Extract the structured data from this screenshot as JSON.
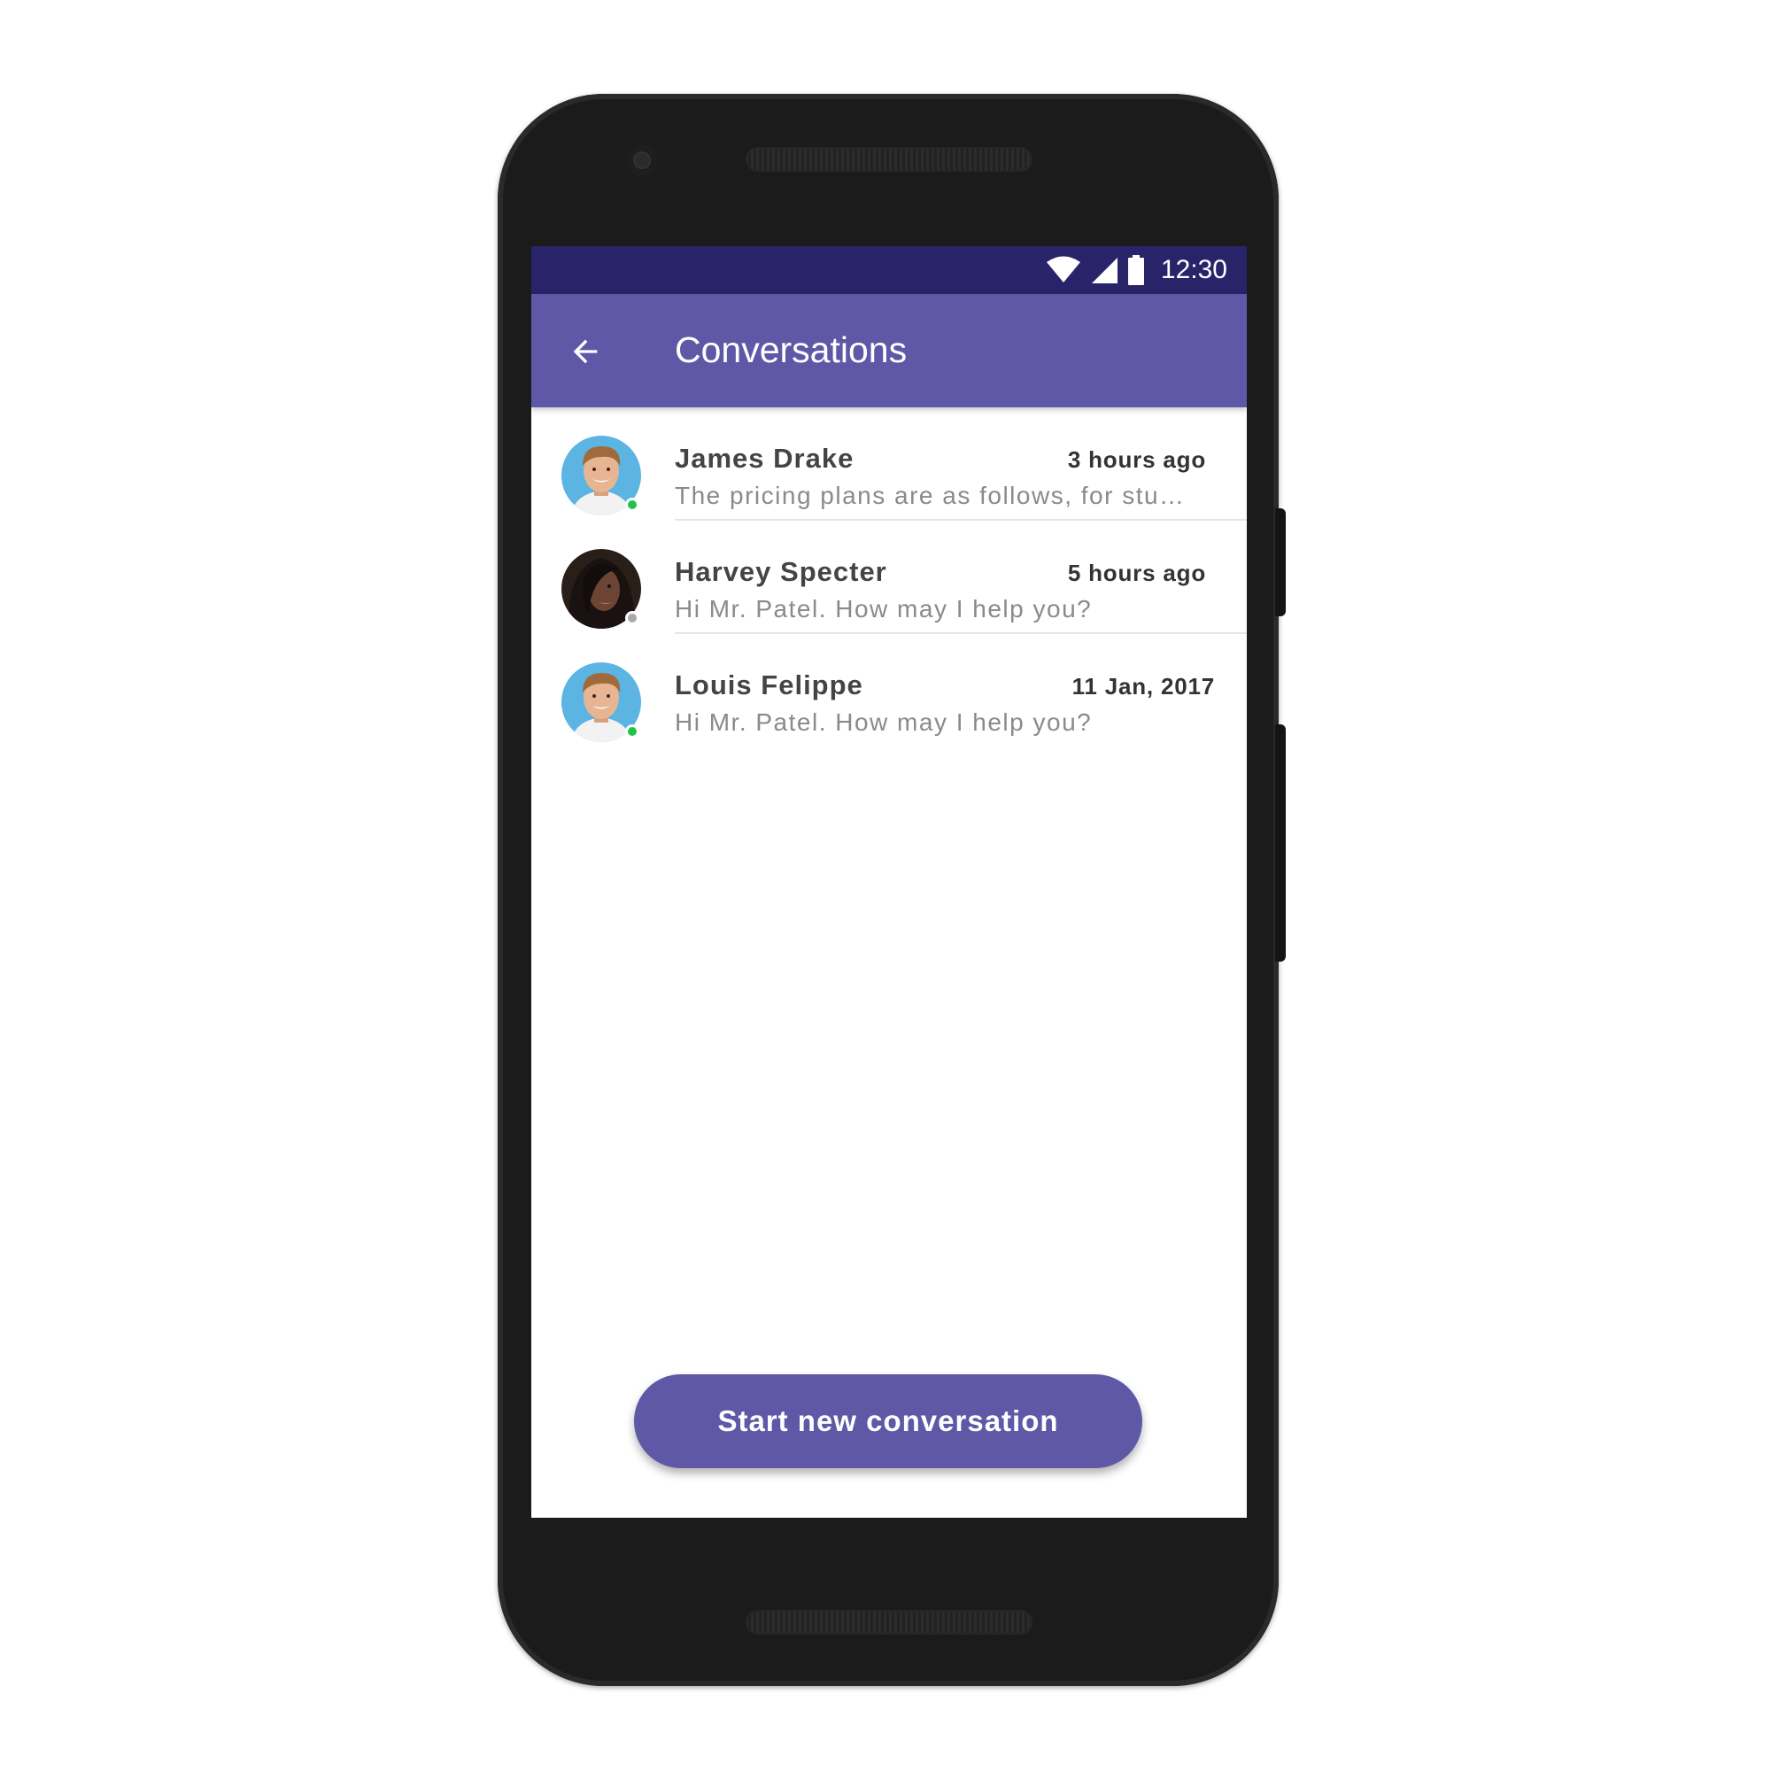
{
  "status_bar": {
    "time": "12:30",
    "icons": [
      "wifi-icon",
      "cell-signal-icon",
      "battery-icon"
    ],
    "background": "#29236a"
  },
  "app_bar": {
    "back_icon": "arrow-back-icon",
    "title": "Conversations",
    "background": "#5e58a7"
  },
  "conversations": [
    {
      "name": "James Drake",
      "time": "3 hours ago",
      "preview": "The pricing plans are as follows, for stu…",
      "avatar": "male-avatar",
      "status": "online",
      "status_color": "#21c24b"
    },
    {
      "name": "Harvey Specter",
      "time": "5 hours ago",
      "preview": "Hi Mr. Patel. How may I help you?",
      "avatar": "female-avatar",
      "status": "offline",
      "status_color": "#a8a8a8"
    },
    {
      "name": "Louis Felippe",
      "time": "11 Jan, 2017",
      "preview": "Hi Mr. Patel. How may I help you?",
      "avatar": "male-avatar",
      "status": "online",
      "status_color": "#21c24b"
    }
  ],
  "primary_action": {
    "label": "Start new conversation",
    "color": "#5e58a7"
  }
}
